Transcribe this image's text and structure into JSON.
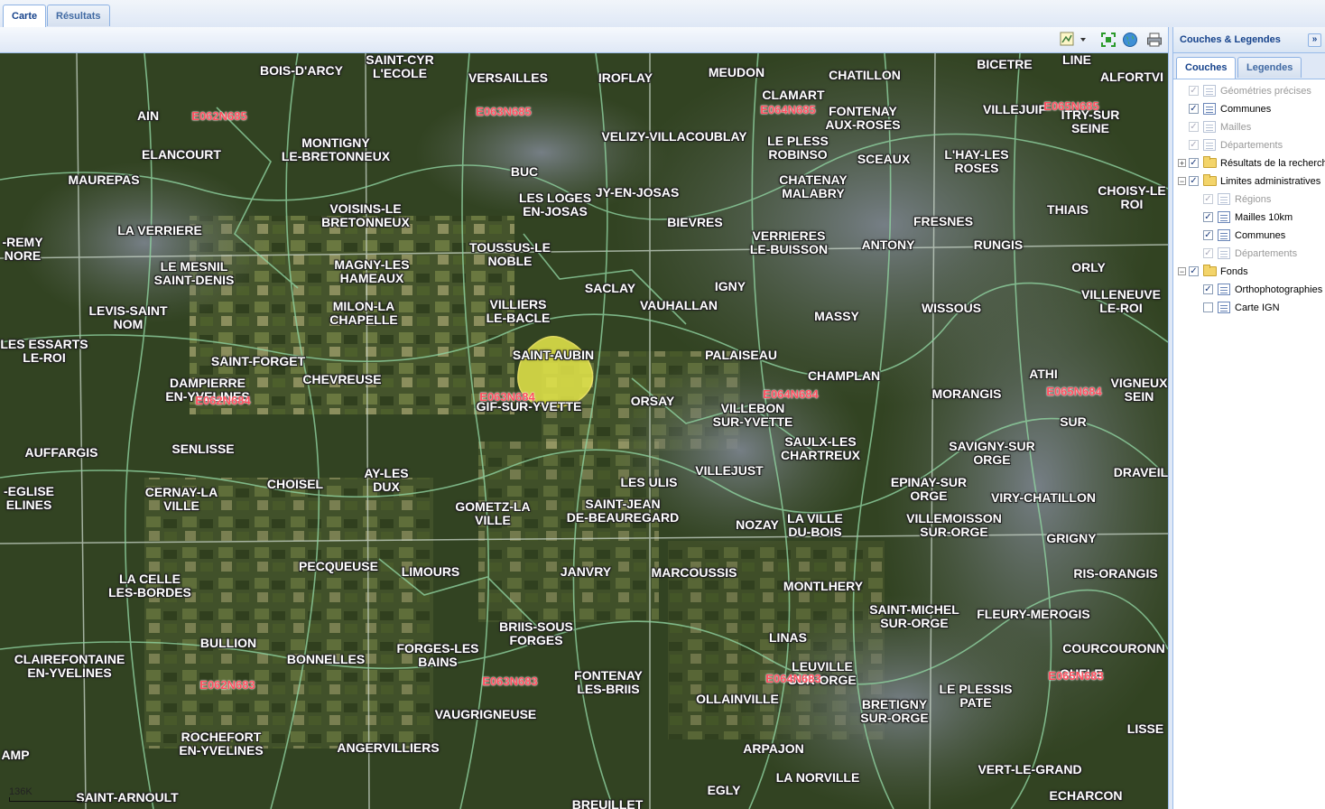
{
  "tabs": [
    {
      "label": "Carte"
    },
    {
      "label": "Résultats"
    }
  ],
  "toolbar_icons": [
    "map-style-icon",
    "dropdown-arrow-icon",
    "zoom-extent-icon",
    "globe-icon",
    "print-icon"
  ],
  "map": {
    "scale": "136K",
    "highlight": {
      "name": "SAINT-AUBIN",
      "color": "#e6e84a"
    },
    "towns": [
      {
        "name": "BOIS-D'ARCY"
      },
      {
        "name": "SAINT-CYR\nL'ECOLE"
      },
      {
        "name": "VERSAILLES"
      },
      {
        "name": "IROFLAY"
      },
      {
        "name": "MEUDON"
      },
      {
        "name": "CHATILLON"
      },
      {
        "name": "BICETRE"
      },
      {
        "name": "ALFORTVI"
      },
      {
        "name": "AIN"
      },
      {
        "name": "CLAMART"
      },
      {
        "name": "FONTENAY\nAUX-ROSES"
      },
      {
        "name": "VILLEJUIF"
      },
      {
        "name": "ITRY-SUR\nSEINE"
      },
      {
        "name": "ELANCOURT"
      },
      {
        "name": "MONTIGNY\nLE-BRETONNEUX"
      },
      {
        "name": "VELIZY-VILLACOUBLAY"
      },
      {
        "name": "LE PLESS\nROBINSO"
      },
      {
        "name": "SCEAUX"
      },
      {
        "name": "L'HAY-LES\nROSES"
      },
      {
        "name": "MAUREPAS"
      },
      {
        "name": "BUC"
      },
      {
        "name": "CHATENAY\nMALABRY"
      },
      {
        "name": "LES LOGES\nEN-JOSAS"
      },
      {
        "name": "JY-EN-JOSAS"
      },
      {
        "name": "CHOISY-LE\nROI"
      },
      {
        "name": "VOISINS-LE\nBRETONNEUX"
      },
      {
        "name": "BIEVRES"
      },
      {
        "name": "FRESNES"
      },
      {
        "name": "THIAIS"
      },
      {
        "name": "LA VERRIERE"
      },
      {
        "name": "VERRIERES\nLE-BUISSON"
      },
      {
        "name": "-REMY\nNORE"
      },
      {
        "name": "TOUSSUS-LE\nNOBLE"
      },
      {
        "name": "ANTONY"
      },
      {
        "name": "RUNGIS"
      },
      {
        "name": "LE MESNIL\nSAINT-DENIS"
      },
      {
        "name": "MAGNY-LES\nHAMEAUX"
      },
      {
        "name": "ORLY"
      },
      {
        "name": "SACLAY"
      },
      {
        "name": "IGNY"
      },
      {
        "name": "VILLENEUVE\nLE-ROI"
      },
      {
        "name": "VILLIERS\nLE-BACLE"
      },
      {
        "name": "VAUHALLAN"
      },
      {
        "name": "LEVIS-SAINT\nNOM"
      },
      {
        "name": "MILON-LA\nCHAPELLE"
      },
      {
        "name": "WISSOUS"
      },
      {
        "name": "MASSY"
      },
      {
        "name": "LES ESSARTS\nLE-ROI"
      },
      {
        "name": "SAINT-AUBIN"
      },
      {
        "name": "PALAISEAU"
      },
      {
        "name": "SAINT-FORGET"
      },
      {
        "name": "ATHI"
      },
      {
        "name": "CHAMPLAN"
      },
      {
        "name": "CHEVREUSE"
      },
      {
        "name": "VIGNEUX\nSEIN"
      },
      {
        "name": "DAMPIERRE\nEN-YVELINES"
      },
      {
        "name": "MORANGIS"
      },
      {
        "name": "ORSAY"
      },
      {
        "name": "GIF-SUR-YVETTE"
      },
      {
        "name": "VILLEBON\nSUR-YVETTE"
      },
      {
        "name": "SUR"
      },
      {
        "name": "SAULX-LES\nCHARTREUX"
      },
      {
        "name": "AUFFARGIS"
      },
      {
        "name": "SENLISSE"
      },
      {
        "name": "SAVIGNY-SUR\nORGE"
      },
      {
        "name": "DRAVEIL"
      },
      {
        "name": "VILLEJUST"
      },
      {
        "name": "AY-LES\nDUX"
      },
      {
        "name": "CHOISEL"
      },
      {
        "name": "LES ULIS"
      },
      {
        "name": "-EGLISE\nELINES"
      },
      {
        "name": "CERNAY-LA\nVILLE"
      },
      {
        "name": "EPINAY-SUR\nORGE"
      },
      {
        "name": "VIRY-CHATILLON"
      },
      {
        "name": "SAINT-JEAN\nDE-BEAUREGARD"
      },
      {
        "name": "GOMETZ-LA\nVILLE"
      },
      {
        "name": "NOZAY"
      },
      {
        "name": "LA VILLE\nDU-BOIS"
      },
      {
        "name": "VILLEMOISSON\nSUR-ORGE"
      },
      {
        "name": "GRIGNY"
      },
      {
        "name": "PECQUEUSE"
      },
      {
        "name": "LIMOURS"
      },
      {
        "name": "JANVRY"
      },
      {
        "name": "MARCOUSSIS"
      },
      {
        "name": "LA CELLE\nLES-BORDES"
      },
      {
        "name": "RIS-ORANGIS"
      },
      {
        "name": "MONTLHERY"
      },
      {
        "name": "SAINT-MICHEL\nSUR-ORGE"
      },
      {
        "name": "FLEURY-MEROGIS"
      },
      {
        "name": "BRIIS-SOUS\nFORGES"
      },
      {
        "name": "BULLION"
      },
      {
        "name": "LINAS"
      },
      {
        "name": "FORGES-LES\nBAINS"
      },
      {
        "name": "COURCOURONN"
      },
      {
        "name": "BONNELLES"
      },
      {
        "name": "CLAIREFONTAINE\nEN-YVELINES"
      },
      {
        "name": "LEUVILLE\nSUR-ORGE"
      },
      {
        "name": "OUFLE"
      },
      {
        "name": "FONTENAY\nLES-BRIIS"
      },
      {
        "name": "LE PLESSIS\nPATE"
      },
      {
        "name": "OLLAINVILLE"
      },
      {
        "name": "BRETIGNY\nSUR-ORGE"
      },
      {
        "name": "VAUGRIGNEUSE"
      },
      {
        "name": "ROCHEFORT\nEN-YVELINES"
      },
      {
        "name": "LISSE"
      },
      {
        "name": "ANGERVILLIERS"
      },
      {
        "name": "ARPAJON"
      },
      {
        "name": "AMP"
      },
      {
        "name": "VERT-LE-GRAND"
      },
      {
        "name": "LA NORVILLE"
      },
      {
        "name": "EGLY"
      },
      {
        "name": "SAINT-ARNOULT"
      },
      {
        "name": "ECHARCON"
      },
      {
        "name": "BREUILLET"
      },
      {
        "name": "LINE"
      }
    ],
    "grid_labels": [
      {
        "name": "E062N685"
      },
      {
        "name": "E063N685"
      },
      {
        "name": "E064N685"
      },
      {
        "name": "E065N685"
      },
      {
        "name": "E063N684"
      },
      {
        "name": "E064N684"
      },
      {
        "name": "E065N684"
      },
      {
        "name": "E062N684"
      },
      {
        "name": "E062N683"
      },
      {
        "name": "E063N683"
      },
      {
        "name": "E064N683"
      },
      {
        "name": "E065N683"
      }
    ]
  },
  "side_panel": {
    "title": "Couches & Legendes",
    "tabs": [
      {
        "label": "Couches"
      },
      {
        "label": "Legendes"
      }
    ],
    "tree": [
      {
        "label": "Géométries précises",
        "checked": true,
        "disabled": true,
        "level": 0,
        "kind": "layer"
      },
      {
        "label": "Communes",
        "checked": true,
        "disabled": false,
        "level": 0,
        "kind": "layer"
      },
      {
        "label": "Mailles",
        "checked": true,
        "disabled": true,
        "level": 0,
        "kind": "layer"
      },
      {
        "label": "Départements",
        "checked": true,
        "disabled": true,
        "level": 0,
        "kind": "layer"
      },
      {
        "label": "Résultats de la recherch",
        "checked": true,
        "disabled": false,
        "level": 0,
        "kind": "folder",
        "expander": "+"
      },
      {
        "label": "Limites administratives",
        "checked": true,
        "disabled": false,
        "level": 0,
        "kind": "folder",
        "expander": "-"
      },
      {
        "label": "Régions",
        "checked": true,
        "disabled": true,
        "level": 1,
        "kind": "layer"
      },
      {
        "label": "Mailles 10km",
        "checked": true,
        "disabled": false,
        "level": 1,
        "kind": "layer"
      },
      {
        "label": "Communes",
        "checked": true,
        "disabled": false,
        "level": 1,
        "kind": "layer"
      },
      {
        "label": "Départements",
        "checked": true,
        "disabled": true,
        "level": 1,
        "kind": "layer"
      },
      {
        "label": "Fonds",
        "checked": true,
        "disabled": false,
        "level": 0,
        "kind": "folder",
        "expander": "-"
      },
      {
        "label": "Orthophotographies",
        "checked": true,
        "disabled": false,
        "level": 1,
        "kind": "layer"
      },
      {
        "label": "Carte IGN",
        "checked": false,
        "disabled": false,
        "level": 1,
        "kind": "layer"
      }
    ]
  }
}
